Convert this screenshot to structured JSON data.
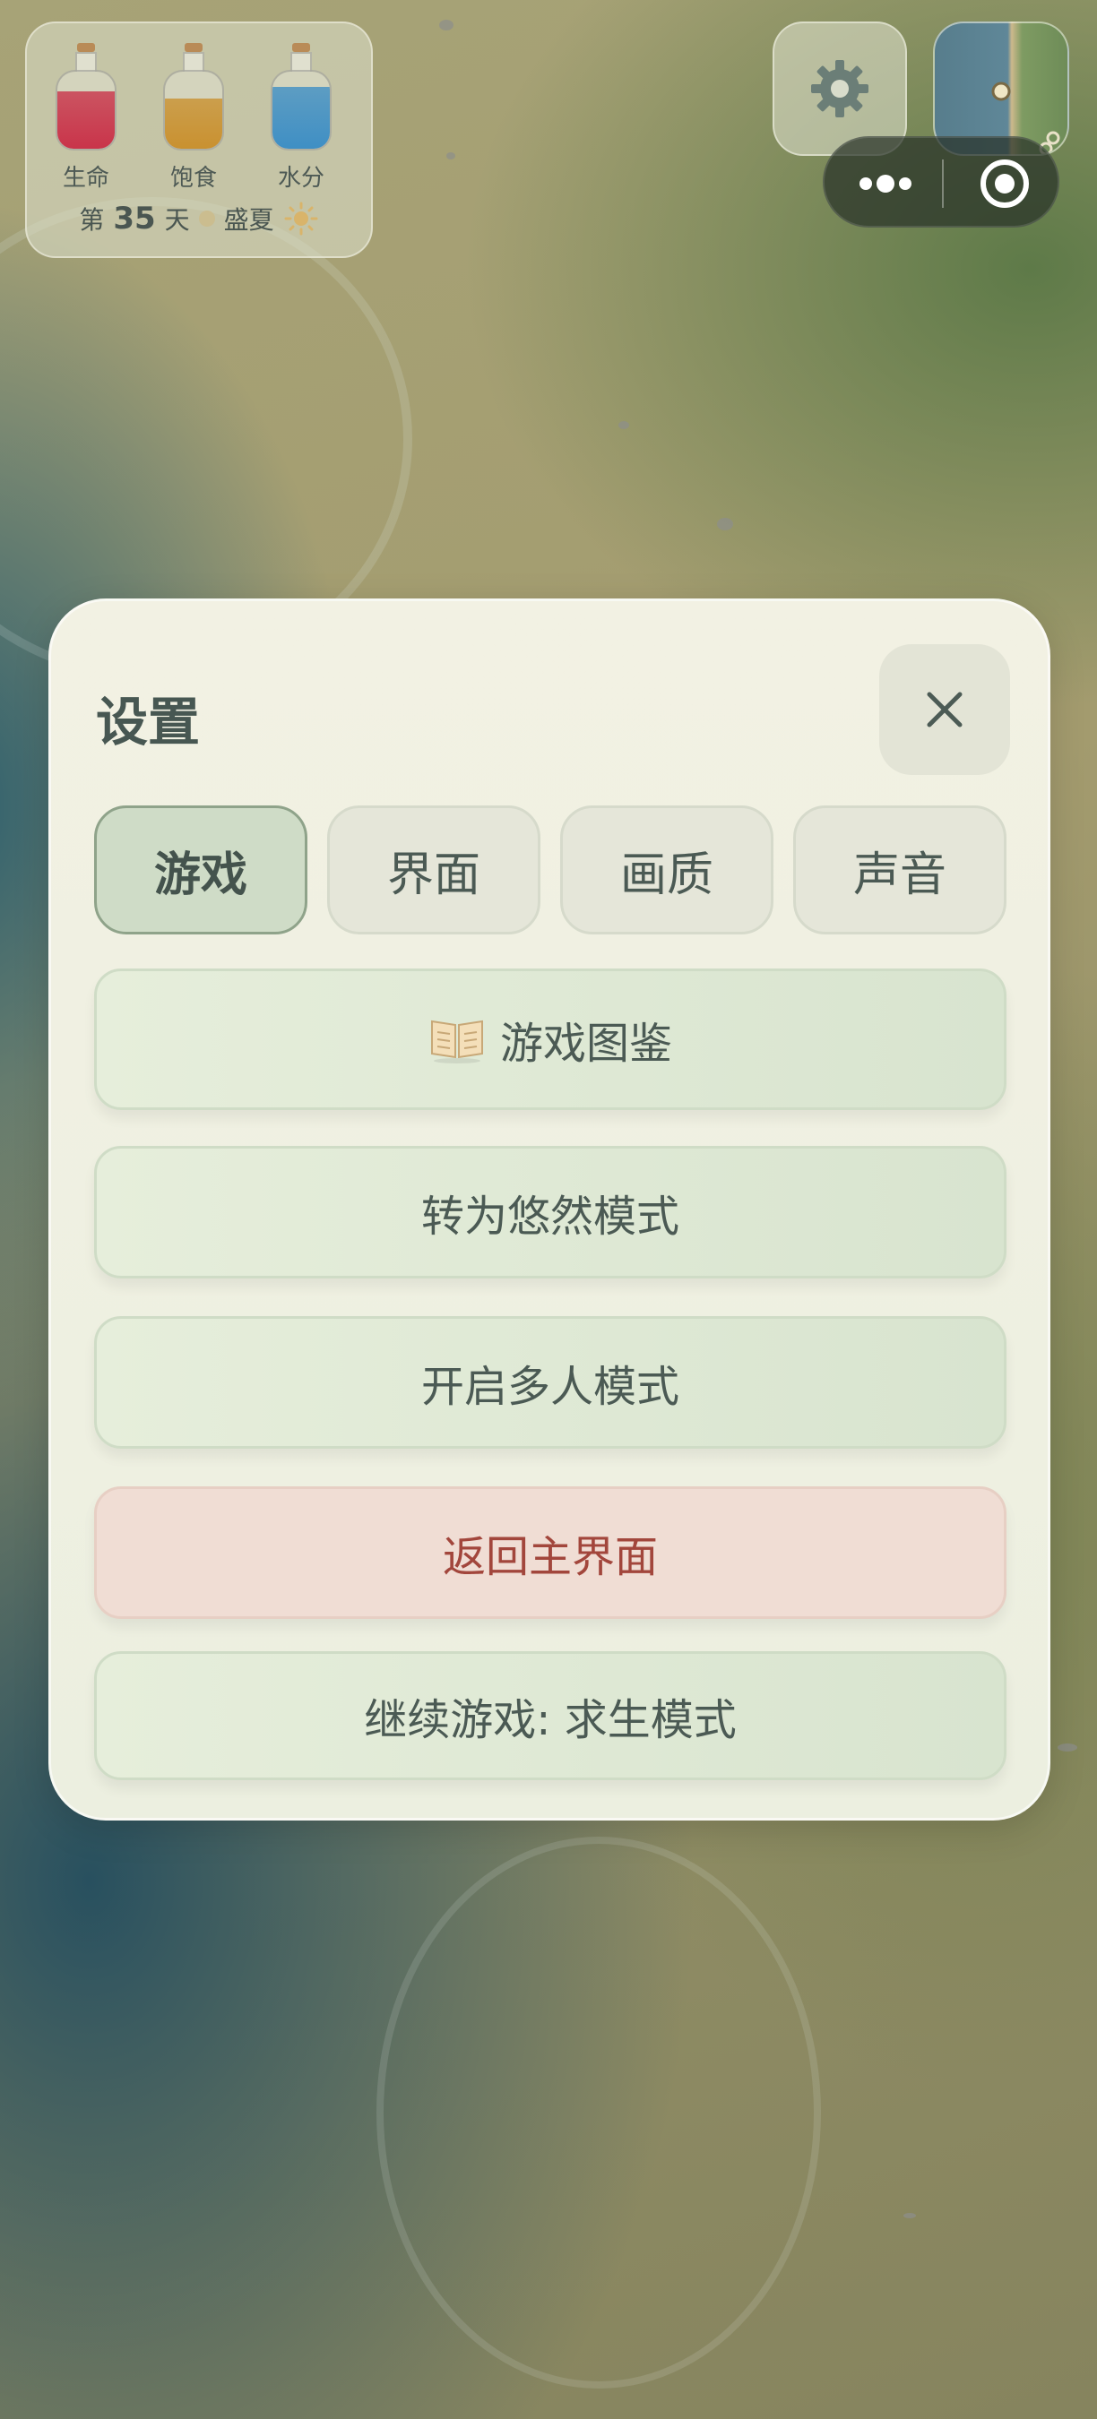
{
  "hud": {
    "stats": [
      {
        "label": "生命",
        "color": "#c9344a",
        "level": 0.75
      },
      {
        "label": "饱食",
        "color": "#c99130",
        "level": 0.65
      },
      {
        "label": "水分",
        "color": "#3f8fc4",
        "level": 0.8
      }
    ],
    "day_prefix": "第",
    "day_number": "35",
    "day_suffix": "天",
    "season": "盛夏",
    "weather_icon": "sun-icon"
  },
  "top_right": {
    "settings_icon": "gear-icon",
    "minimap_icon": "minimap",
    "capsule_more_icon": "more-dots-icon",
    "capsule_close_icon": "target-icon"
  },
  "dialog": {
    "title": "设置",
    "close_icon": "close-icon",
    "tabs": [
      {
        "label": "游戏",
        "active": true
      },
      {
        "label": "界面",
        "active": false
      },
      {
        "label": "画质",
        "active": false
      },
      {
        "label": "声音",
        "active": false
      }
    ],
    "buttons": {
      "encyclopedia": "游戏图鉴",
      "relax_mode": "转为悠然模式",
      "multiplayer": "开启多人模式",
      "main_menu": "返回主界面",
      "continue": "继续游戏: 求生模式"
    },
    "colors": {
      "accent": "#8fa38a",
      "danger_text": "#a2463c"
    }
  }
}
